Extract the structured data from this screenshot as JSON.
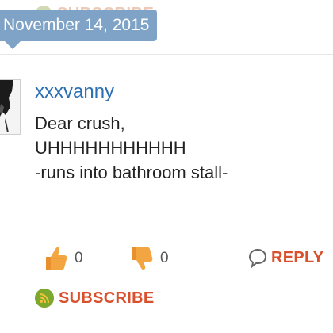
{
  "date_badge": "November 14, 2015",
  "comment": {
    "username": "xxxvanny",
    "lines": [
      "Dear crush,",
      "",
      "UHHHHHHHHHHH",
      "-runs into bathroom stall-"
    ],
    "upvotes": "0",
    "downvotes": "0",
    "reply_label": "REPLY"
  },
  "subscribe_label": "SUBSCRIBE",
  "colors": {
    "date_badge_bg": "#7fa3c6",
    "username": "#2a6fb3",
    "action_orange": "#d9502c",
    "rss_green": "#7da82e",
    "thumb_orange": "#f0a03a"
  },
  "icons": {
    "upvote": "thumbs-up-icon",
    "downvote": "thumbs-down-icon",
    "reply": "speech-bubble-icon",
    "subscribe": "rss-icon"
  }
}
